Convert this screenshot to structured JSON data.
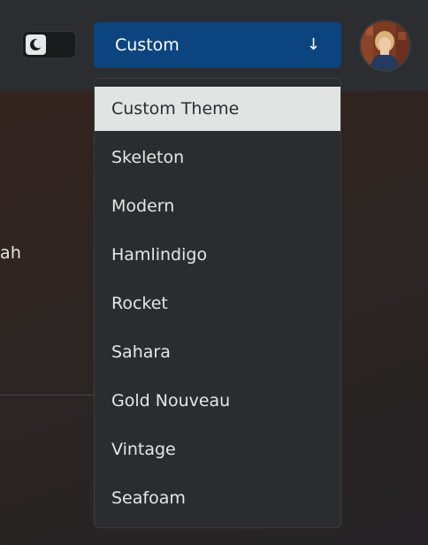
{
  "header": {
    "theme_button_label": "Custom",
    "theme_button_arrow": "↓",
    "mode_toggle_icon": "moon-icon",
    "avatar": "user-avatar"
  },
  "background": {
    "partial_text": "ah"
  },
  "theme_menu": {
    "selected_index": 0,
    "items": [
      {
        "label": "Custom Theme"
      },
      {
        "label": "Skeleton"
      },
      {
        "label": "Modern"
      },
      {
        "label": "Hamlindigo"
      },
      {
        "label": "Rocket"
      },
      {
        "label": "Sahara"
      },
      {
        "label": "Gold Nouveau"
      },
      {
        "label": "Vintage"
      },
      {
        "label": "Seafoam"
      }
    ]
  },
  "colors": {
    "accent": "#0c447f",
    "selected_item_bg": "#e2e4e3",
    "menu_bg": "#2b2c2f"
  }
}
